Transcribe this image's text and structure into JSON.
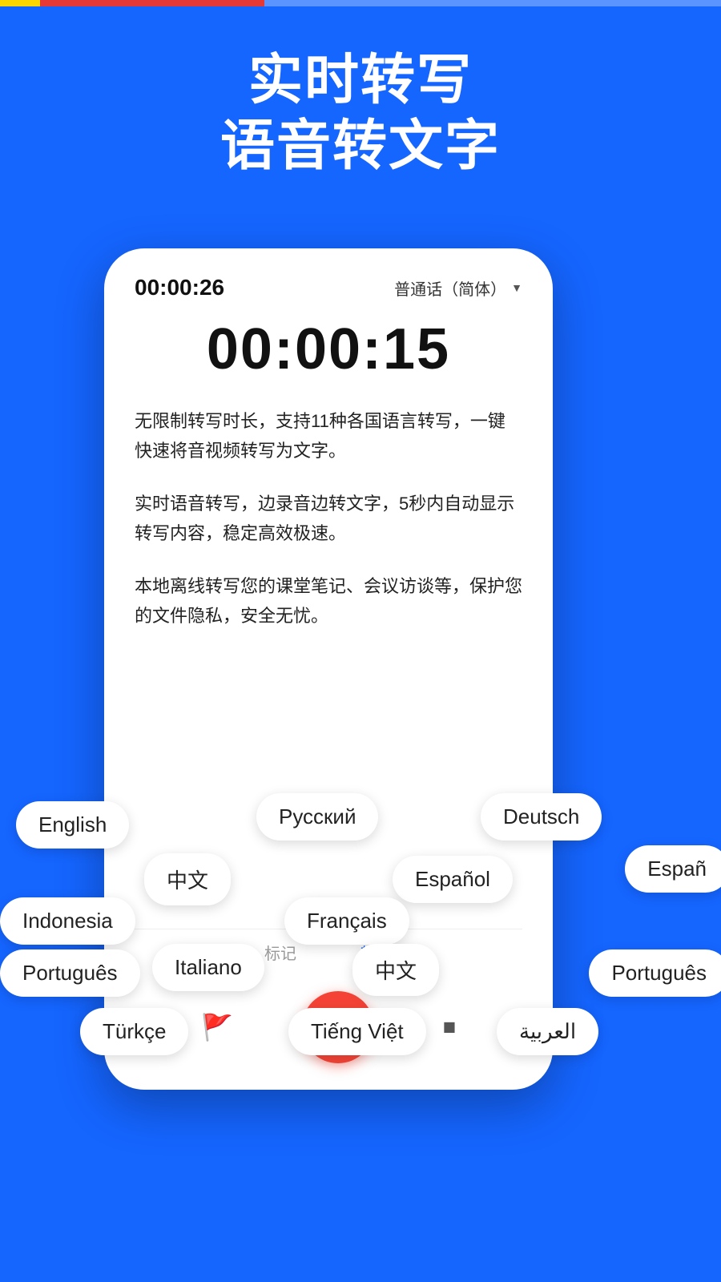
{
  "progressBar": {
    "segments": [
      "yellow",
      "red",
      "white"
    ]
  },
  "heroTitle": {
    "line1": "实时转写",
    "line2": "语音转文字"
  },
  "phone": {
    "timerSmall": "00:00:26",
    "langSelector": "普通话（简体）",
    "timerLarge": "00:00:15",
    "paragraph1": "无限制转写时长，支持11种各国语言转写，一键快速将音视频转写为文字。",
    "paragraph2": "实时语音转写，边录音边转文字，5秒内自动显示转写内容，稳定高效极速。",
    "paragraph3": "本地离线转写您的课堂笔记、会议访谈等，保护您的文件隐私，安全无忧。",
    "tabLabel1": "标记",
    "tabLabel2": "转写",
    "pauseAriaLabel": "pause"
  },
  "languageTags": [
    {
      "id": "english",
      "label": "English"
    },
    {
      "id": "russian",
      "label": "Русский"
    },
    {
      "id": "deutsch",
      "label": "Deutsch"
    },
    {
      "id": "chinese1",
      "label": "中文"
    },
    {
      "id": "espanol",
      "label": "Español"
    },
    {
      "id": "espanol2",
      "label": "Españ"
    },
    {
      "id": "indonesia",
      "label": "Indonesia"
    },
    {
      "id": "francais",
      "label": "Français"
    },
    {
      "id": "italiano",
      "label": "Italiano"
    },
    {
      "id": "chinese2",
      "label": "中文"
    },
    {
      "id": "portugues1",
      "label": "Português"
    },
    {
      "id": "portugues2",
      "label": "Português"
    },
    {
      "id": "turkce",
      "label": "Türkçe"
    },
    {
      "id": "tieng-viet",
      "label": "Tiếng Việt"
    },
    {
      "id": "arabic",
      "label": "العربية"
    }
  ]
}
